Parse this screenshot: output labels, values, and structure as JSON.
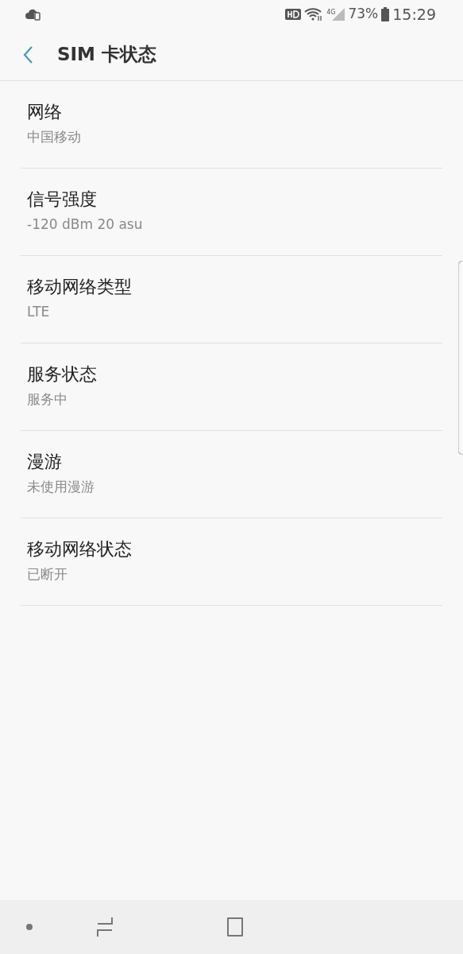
{
  "status_bar": {
    "battery": "73%",
    "time": "15:29",
    "network_label": "4G"
  },
  "header": {
    "title": "SIM 卡状态"
  },
  "items": [
    {
      "title": "网络",
      "value": "中国移动"
    },
    {
      "title": "信号强度",
      "value": "-120 dBm 20 asu"
    },
    {
      "title": "移动网络类型",
      "value": "LTE"
    },
    {
      "title": "服务状态",
      "value": "服务中"
    },
    {
      "title": "漫游",
      "value": "未使用漫游"
    },
    {
      "title": "移动网络状态",
      "value": "已断开"
    }
  ]
}
